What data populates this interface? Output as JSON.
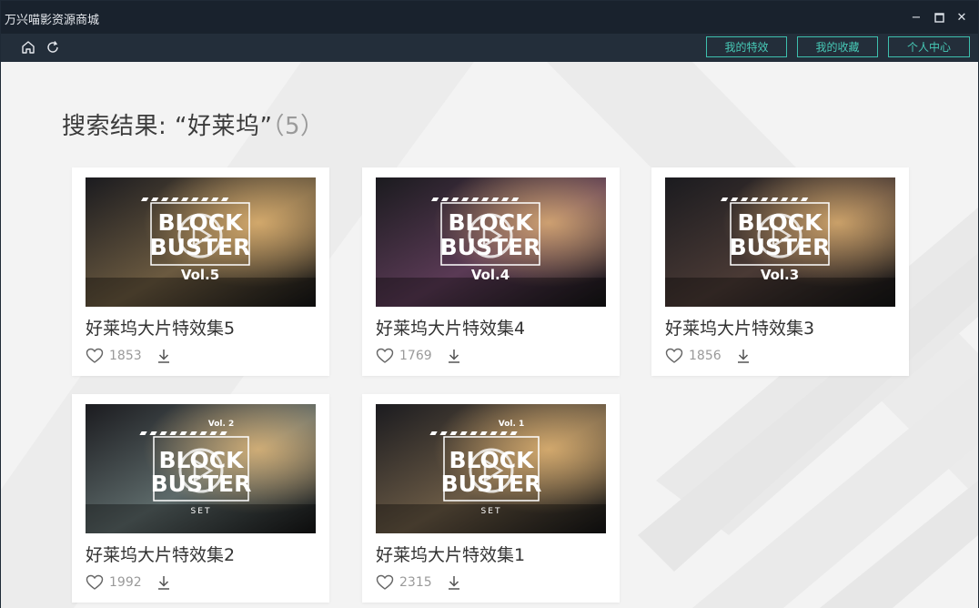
{
  "window": {
    "title": "万兴喵影资源商城",
    "minimize_glyph": "−",
    "maximize_glyph": "☐",
    "close_glyph": "✕"
  },
  "toolbar": {
    "home_icon": "home-icon",
    "refresh_icon": "refresh-icon",
    "buttons": [
      {
        "label": "我的特效"
      },
      {
        "label": "我的收藏"
      },
      {
        "label": "个人中心"
      }
    ],
    "accent": "#3dbfae"
  },
  "search": {
    "prefix": "搜索结果: ",
    "query": "“好莱坞”",
    "count": "（5）"
  },
  "results": [
    {
      "title": "好莱坞大片特效集5",
      "likes": "1853",
      "thumb_text": [
        "BLOCK",
        "BUSTER",
        "Vol.5"
      ],
      "theme": "#6b5a40"
    },
    {
      "title": "好莱坞大片特效集4",
      "likes": "1769",
      "thumb_text": [
        "BLOCK",
        "BUSTER",
        "Vol.4"
      ],
      "theme": "#5a3a55"
    },
    {
      "title": "好莱坞大片特效集3",
      "likes": "1856",
      "thumb_text": [
        "BLOCK",
        "BUSTER",
        "Vol.3"
      ],
      "theme": "#4a3a35"
    },
    {
      "title": "好莱坞大片特效集2",
      "likes": "1992",
      "thumb_text": [
        "Vol. 2",
        "BLOCK",
        "BUSTER",
        "SET"
      ],
      "theme": "#5d6a6a"
    },
    {
      "title": "好莱坞大片特效集1",
      "likes": "2315",
      "thumb_text": [
        "Vol. 1",
        "BLOCK",
        "BUSTER",
        "SET"
      ],
      "theme": "#6a5a45"
    }
  ]
}
